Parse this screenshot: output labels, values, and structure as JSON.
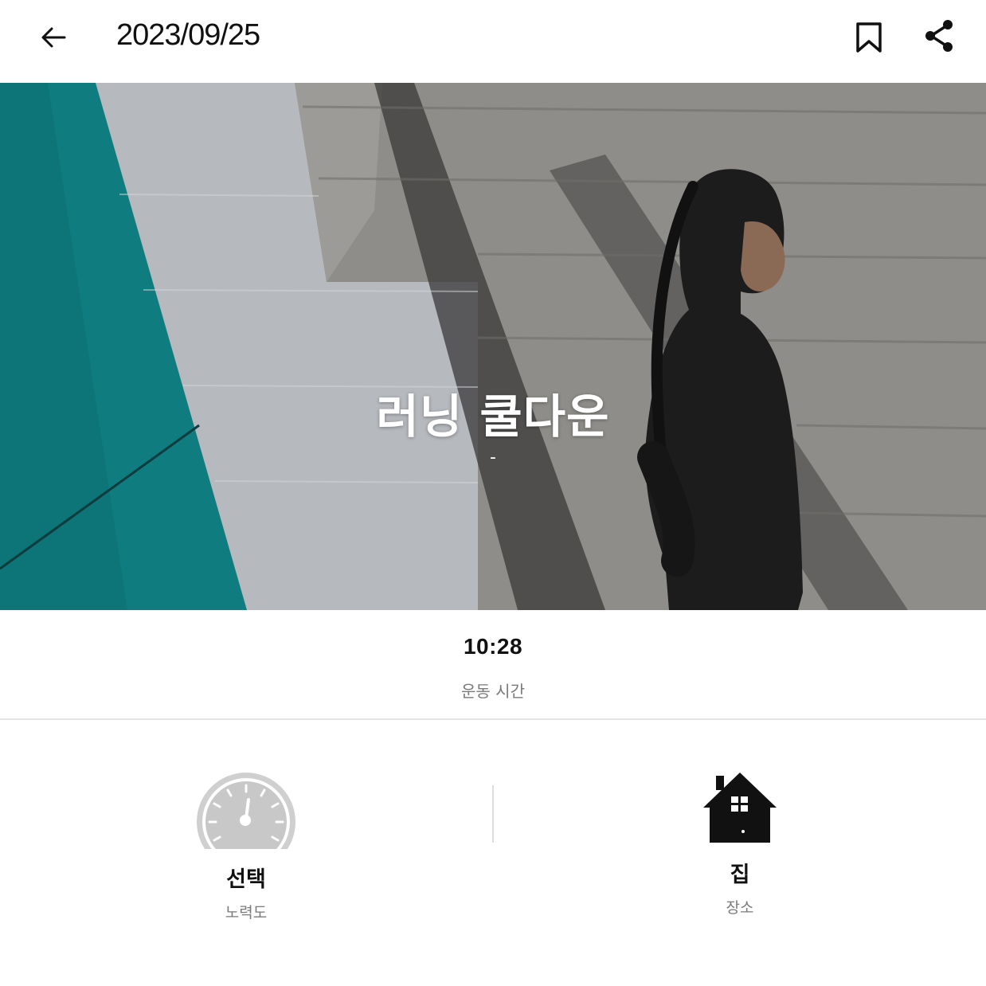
{
  "header": {
    "date": "2023/09/25",
    "back_icon": "arrow-left-icon",
    "bookmark_icon": "bookmark-icon",
    "share_icon": "share-icon"
  },
  "hero": {
    "title": "러닝 쿨다운",
    "subtitle": "-",
    "image_description_colors": {
      "teal": "#0e7f82",
      "wall": "#8f8e8a",
      "light_panel": "#b9bcc2"
    }
  },
  "workout": {
    "time_value": "10:28",
    "time_label": "운동 시간"
  },
  "stats": {
    "effort": {
      "value": "선택",
      "label": "노력도",
      "icon": "speedometer-icon"
    },
    "location": {
      "value": "집",
      "label": "장소",
      "icon": "house-icon"
    }
  },
  "colors": {
    "text_primary": "#111111",
    "text_secondary": "#7a7a7a",
    "divider": "#e4e4e4",
    "gauge": "#c8c8c8"
  }
}
